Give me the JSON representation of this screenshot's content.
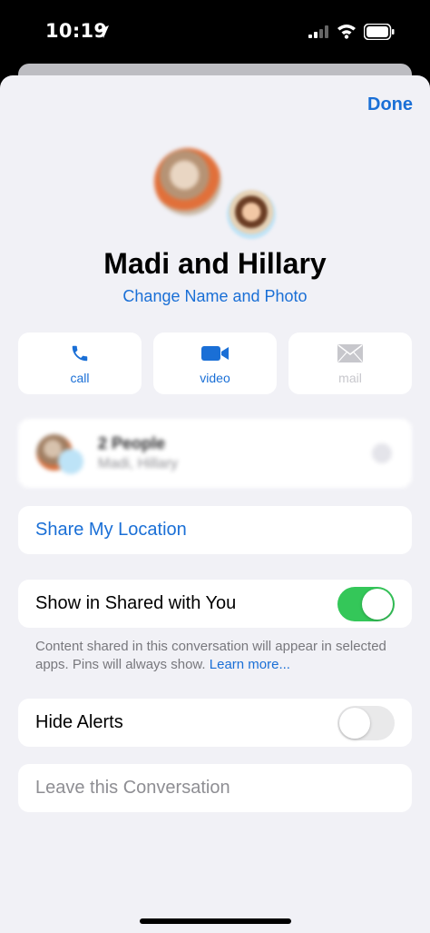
{
  "status_bar": {
    "time": "10:19"
  },
  "header": {
    "done_label": "Done"
  },
  "contact": {
    "name": "Madi and Hillary",
    "change_link": "Change Name and Photo"
  },
  "actions": [
    {
      "label": "call",
      "icon": "phone-icon",
      "enabled": true
    },
    {
      "label": "video",
      "icon": "video-camera-icon",
      "enabled": true
    },
    {
      "label": "mail",
      "icon": "envelope-icon",
      "enabled": false
    }
  ],
  "people_card": {
    "title": "2 People",
    "subtitle": "Madi, Hillary"
  },
  "share_location": {
    "label": "Share My Location"
  },
  "shared_with_you": {
    "label": "Show in Shared with You",
    "enabled": true,
    "footnote": "Content shared in this conversation will appear in selected apps. Pins will always show.",
    "learn_more": "Learn more..."
  },
  "hide_alerts": {
    "label": "Hide Alerts",
    "enabled": false
  },
  "leave": {
    "label": "Leave this Conversation"
  },
  "colors": {
    "accent": "#1a6fd6",
    "toggle_on": "#34c759",
    "background": "#f1f1f6"
  }
}
